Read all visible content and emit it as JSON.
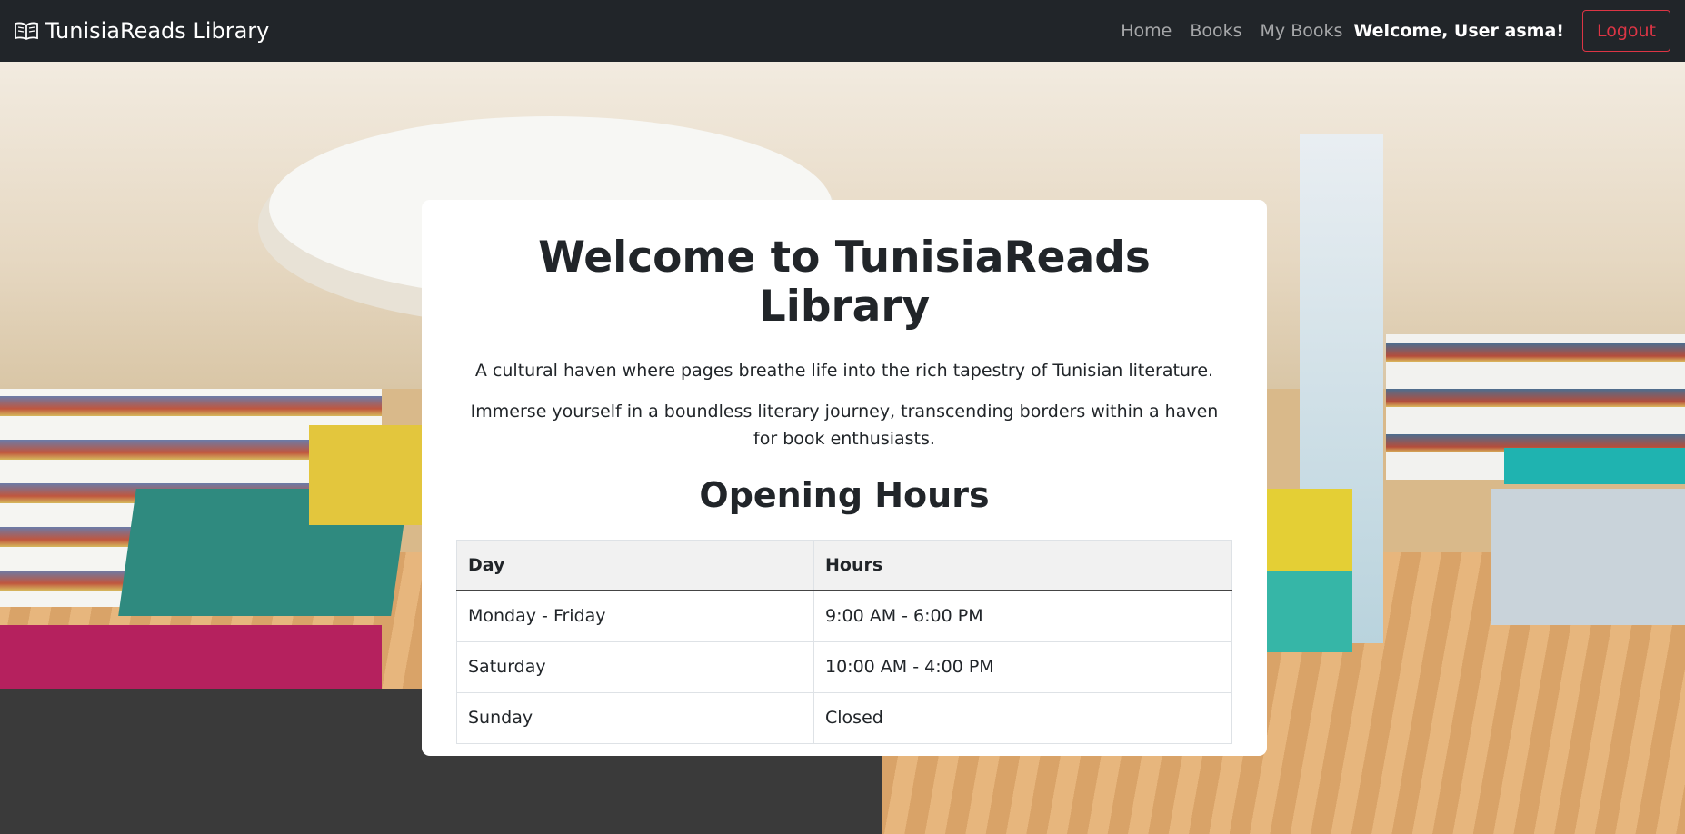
{
  "navbar": {
    "brand_icon": "open-book-icon",
    "brand": "TunisiaReads Library",
    "links": [
      "Home",
      "Books",
      "My Books"
    ],
    "welcome": "Welcome, User asma!",
    "logout": "Logout",
    "colors": {
      "bg": "#212529",
      "logout": "#dc3545"
    }
  },
  "hero": {
    "title": "Welcome to TunisiaReads Library",
    "intro": "A cultural haven where pages breathe life into the rich tapestry of Tunisian literature.",
    "intro2": "Immerse yourself in a boundless literary journey, transcending borders within a haven for book enthusiasts."
  },
  "hours": {
    "heading": "Opening Hours",
    "columns": [
      "Day",
      "Hours"
    ],
    "rows": [
      [
        "Monday - Friday",
        "9:00 AM - 6:00 PM"
      ],
      [
        "Saturday",
        "10:00 AM - 4:00 PM"
      ],
      [
        "Sunday",
        "Closed"
      ]
    ]
  }
}
